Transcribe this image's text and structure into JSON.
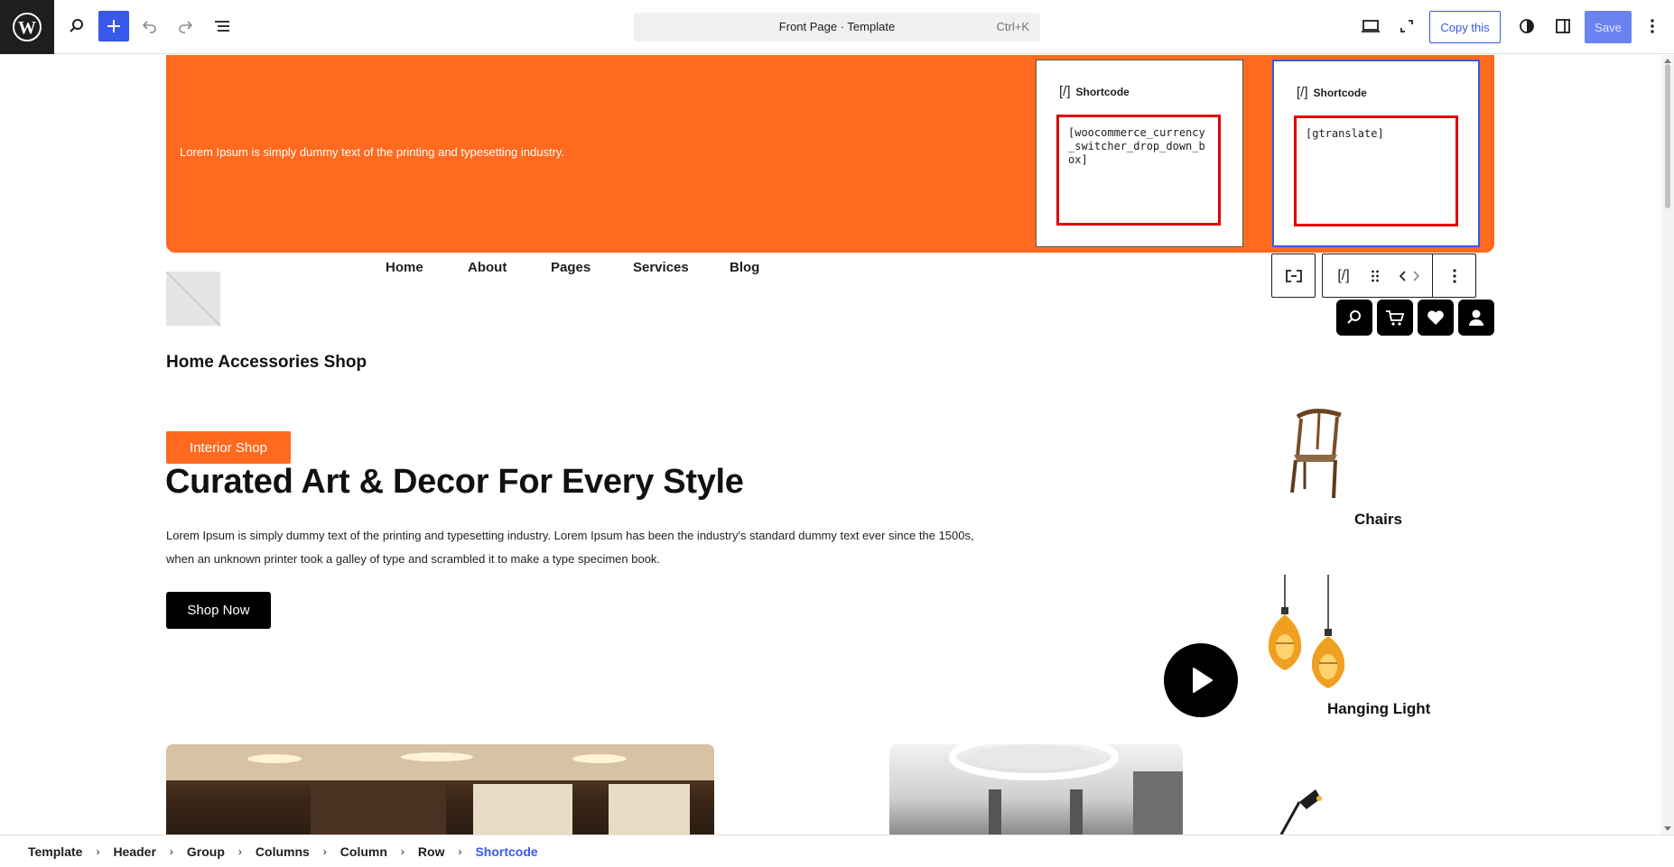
{
  "toolbar": {
    "wp_logo": "W",
    "document_title": "Front Page · Template",
    "shortcut": "Ctrl+K",
    "copy_label": "Copy this",
    "save_label": "Save",
    "icons": [
      "wordpress-icon",
      "search-icon",
      "plus-icon",
      "undo-icon",
      "redo-icon",
      "list-view-icon",
      "desktop-preview-icon",
      "fullscreen-icon",
      "style-contrast-icon",
      "sidebar-icon",
      "more-options-icon"
    ]
  },
  "header_bar": {
    "text": "Lorem Ipsum is simply dummy text of the printing and typesetting industry.",
    "background": "#ff6a1f",
    "shortcodes": [
      {
        "label": "Shortcode",
        "glyph": "[/]",
        "value": "[woocommerce_currency_switcher_drop_down_box]"
      },
      {
        "label": "Shortcode",
        "glyph": "[/]",
        "value": "[gtranslate]"
      }
    ]
  },
  "block_toolbar": {
    "shortcode_glyph": "[/]",
    "icons": [
      "parent-block-icon",
      "shortcode-icon",
      "drag-handle-icon",
      "move-arrows-icon",
      "more-options-icon"
    ]
  },
  "nav": {
    "items": [
      "Home",
      "About",
      "Pages",
      "Services",
      "Blog"
    ],
    "icon_buttons": [
      "search-icon",
      "cart-icon",
      "heart-icon",
      "user-icon"
    ]
  },
  "site_title": "Home Accessories Shop",
  "hero": {
    "badge": "Interior Shop",
    "heading": "Curated Art & Decor For Every Style",
    "text": "Lorem Ipsum is simply dummy text of the printing and typesetting industry. Lorem Ipsum has been the industry's standard dummy text ever since the 1500s, when an unknown printer took a galley of type and scrambled it to make a type specimen book.",
    "button": "Shop Now"
  },
  "categories": [
    {
      "label": "Chairs",
      "image": "chair-image"
    },
    {
      "label": "Hanging Light",
      "image": "hanging-light-image"
    },
    {
      "label": "",
      "image": "desk-lamp-image"
    }
  ],
  "breadcrumb": [
    "Template",
    "Header",
    "Group",
    "Columns",
    "Column",
    "Row",
    "Shortcode"
  ],
  "colors": {
    "accent": "#3858e9",
    "orange": "#ff6a1f",
    "selection_red": "#e00000"
  }
}
